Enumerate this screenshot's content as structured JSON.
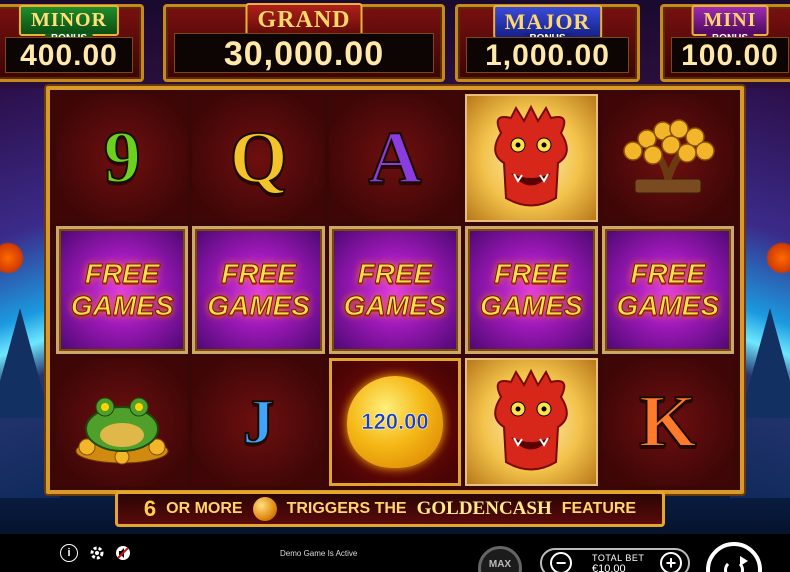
{
  "jackpots": {
    "minor": {
      "title": "MINOR",
      "bonus": "BONUS",
      "value": "400.00"
    },
    "grand": {
      "title": "GRAND",
      "value": "30,000.00"
    },
    "major": {
      "title": "MAJOR",
      "bonus": "BONUS",
      "value": "1,000.00"
    },
    "mini": {
      "title": "MINI",
      "bonus": "BONUS",
      "value": "100.00"
    }
  },
  "reels": {
    "row1": [
      {
        "symbol": "9",
        "color": "#6ad11c"
      },
      {
        "symbol": "Q",
        "color": "#f4c32a"
      },
      {
        "symbol": "A",
        "color": "#8a3ce0"
      },
      {
        "symbol": "dragon-icon"
      },
      {
        "symbol": "money-tree-icon"
      }
    ],
    "free_line1": "FREE",
    "free_line2": "GAMES",
    "row3": [
      {
        "symbol": "golden-toad-icon"
      },
      {
        "symbol": "J",
        "color": "#3da4ff"
      },
      {
        "symbol": "golden-peach-coin-icon",
        "value": "120.00"
      },
      {
        "symbol": "dragon-icon"
      },
      {
        "symbol": "K",
        "color": "#ff7a2a"
      }
    ]
  },
  "banner": {
    "count": "6",
    "or_more": "OR MORE",
    "triggers": "TRIGGERS THE",
    "feature_name": "GOLDENCASH",
    "feature": "FEATURE"
  },
  "footer": {
    "info_icon": "i",
    "demo_text": "Demo Game Is Active",
    "max_label": "MAX",
    "total_bet_label": "TOTAL BET",
    "total_bet_value": "€10.00",
    "minus": "−",
    "plus": "+"
  },
  "colors": {
    "frame_gold": "#d89a2a",
    "reel_bg": "#3e0606",
    "free_purple": "#9a18b5"
  }
}
